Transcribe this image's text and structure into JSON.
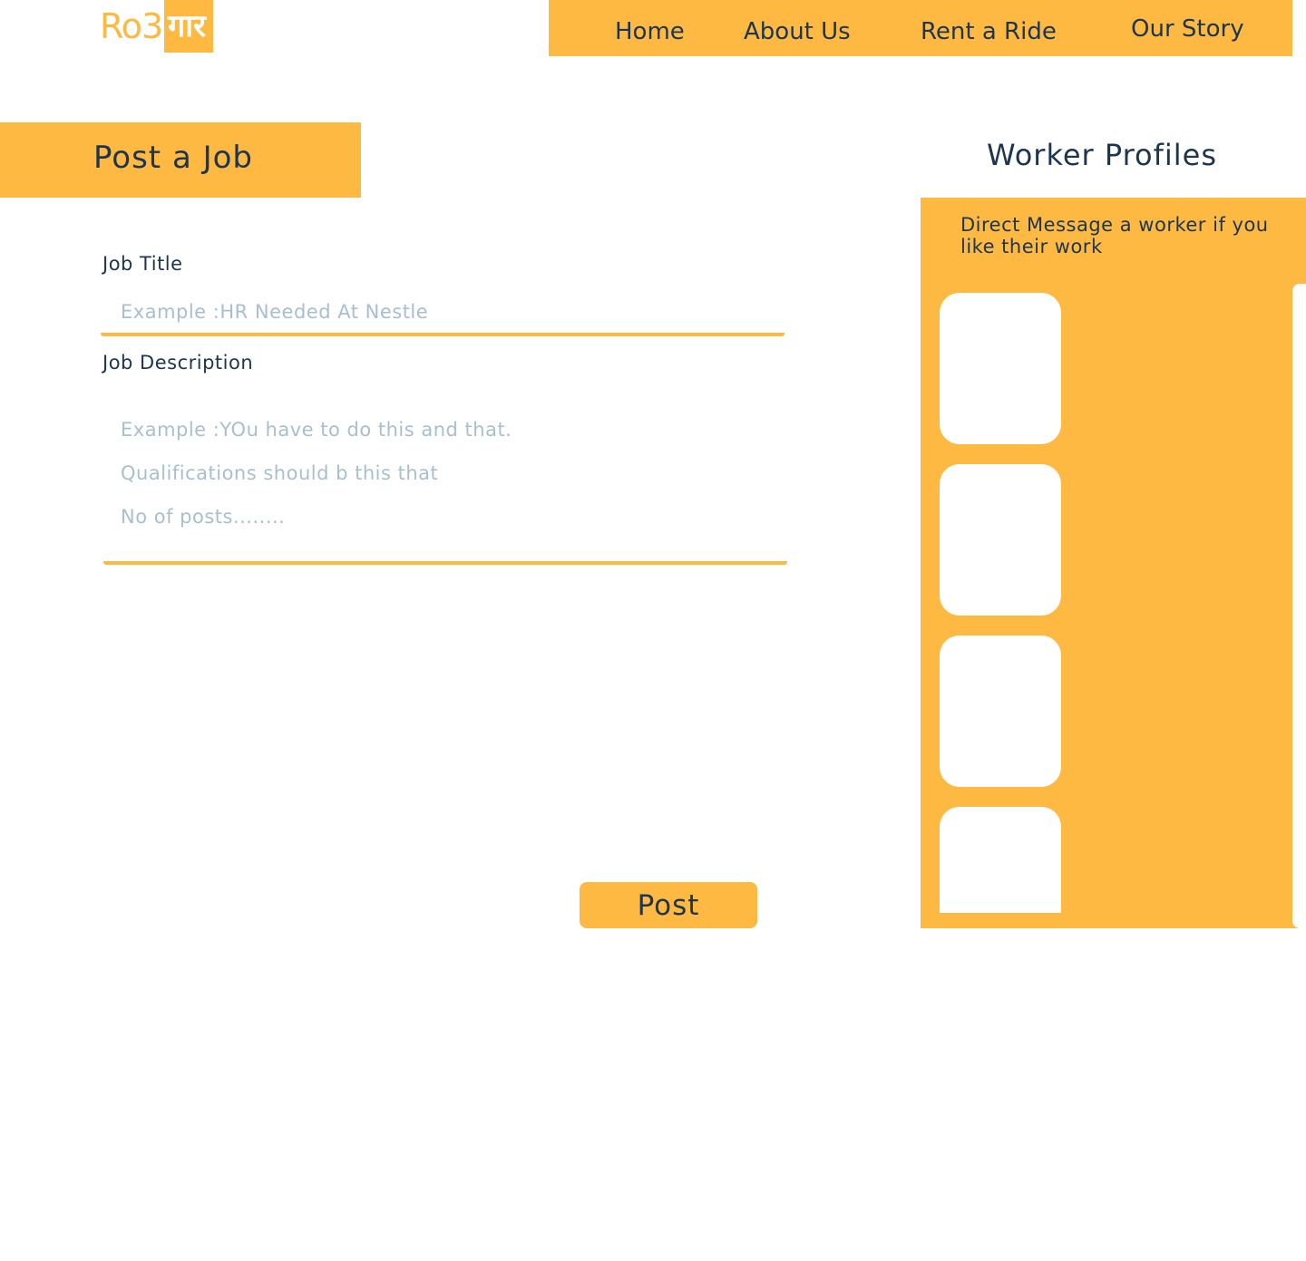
{
  "logo": {
    "left_text": "Ro3",
    "right_text": "गार"
  },
  "nav": {
    "items": [
      {
        "label": "Home"
      },
      {
        "label": "About Us"
      },
      {
        "label": "Rent a Ride"
      },
      {
        "label": "Our Story"
      }
    ]
  },
  "post_job": {
    "heading": "Post a Job",
    "job_title": {
      "label": "Job Title",
      "value": "",
      "placeholder": "Example :HR Needed At Nestle"
    },
    "job_description": {
      "label": "Job Description",
      "value": "",
      "placeholder": "Example :YOu have to do this and that.\nQualifications should b this that\nNo of posts........"
    },
    "submit_label": "Post"
  },
  "worker_profiles": {
    "heading": "Worker Profiles",
    "subtitle": "Direct Message a worker if you like their work",
    "card_count_visible": 4
  },
  "colors": {
    "accent": "#fdb942",
    "text": "#1d3550",
    "placeholder": "#a8bfd0",
    "background": "#ffffff"
  }
}
